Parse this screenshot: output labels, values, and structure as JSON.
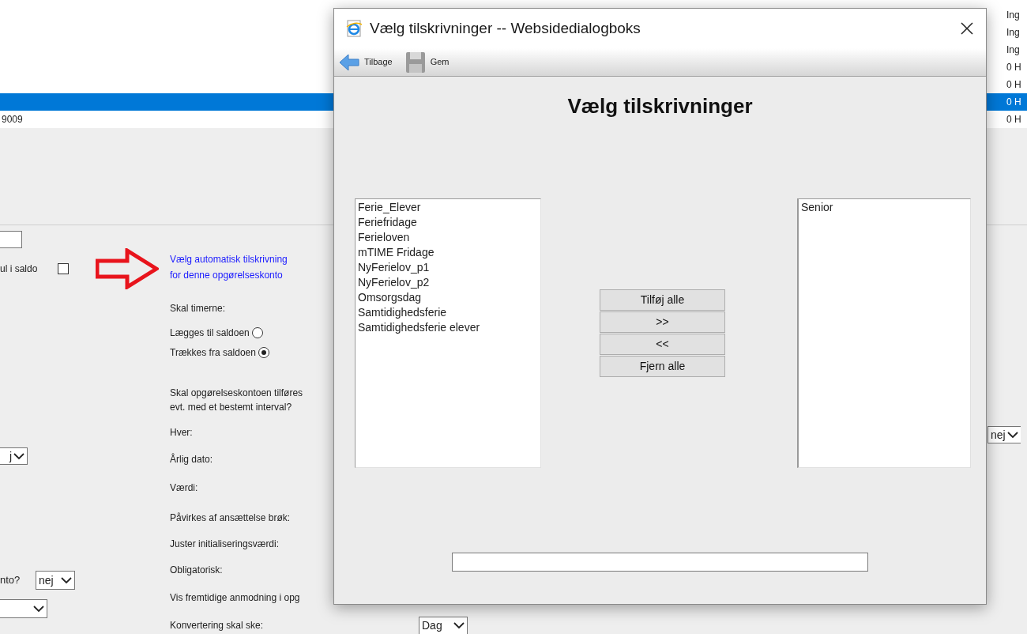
{
  "background_page": {
    "table": {
      "rows": [
        {
          "column_2": "Ing",
          "selected": false
        },
        {
          "column_2": "Ing",
          "selected": false
        },
        {
          "column_2": "Ing",
          "selected": false
        },
        {
          "column_2": "0 H",
          "selected": false
        },
        {
          "column_2": "0 H",
          "selected": false
        },
        {
          "column_2": "0 H",
          "selected": true
        },
        {
          "column_1": "9009",
          "column_2": "0 H",
          "selected": false
        }
      ]
    },
    "form": {
      "checkbox": {
        "label": "ul i saldo",
        "checked": false
      },
      "left_selects": [
        {
          "value": "j"
        },
        {
          "label": "nto?",
          "value": "nej"
        }
      ],
      "link": "Vælg automatisk tilskrivning\nfor denne opgørelseskonto",
      "hours_question": "Skal timerne:",
      "radios": [
        {
          "label": "Lægges til saldoen",
          "selected": false
        },
        {
          "label": "Trækkes fra saldoen",
          "selected": true
        }
      ],
      "interval_question": "Skal opgørelseskontoen tilføres\nevt. med et bestemt interval?",
      "labels": [
        "Hver:",
        "Årlig dato:",
        "Værdi:",
        "Påvirkes af ansættelse brøk:",
        "Juster initialiseringsværdi:",
        "Obligatorisk:",
        "Vis fremtidige anmodning i opg"
      ],
      "conversion": {
        "label": "Konvertering skal ske:",
        "value": "Dag"
      },
      "right_select": {
        "value": "nej"
      }
    }
  },
  "dialog": {
    "title": "Vælg tilskrivninger -- Websidedialogboks",
    "toolbar": [
      {
        "kind": "back",
        "label": "Tilbage"
      },
      {
        "kind": "save",
        "label": "Gem"
      }
    ],
    "heading": "Vælg tilskrivninger",
    "available": [
      "Ferie_Elever",
      "Feriefridage",
      "Ferieloven",
      "mTIME Fridage",
      "NyFerielov_p1",
      "NyFerielov_p2",
      "Omsorgsdag",
      "Samtidighedsferie",
      "Samtidighedsferie elever"
    ],
    "buttons": [
      "Tilføj alle",
      ">>",
      "<<",
      "Fjern alle"
    ],
    "chosen": [
      "Senior"
    ]
  }
}
